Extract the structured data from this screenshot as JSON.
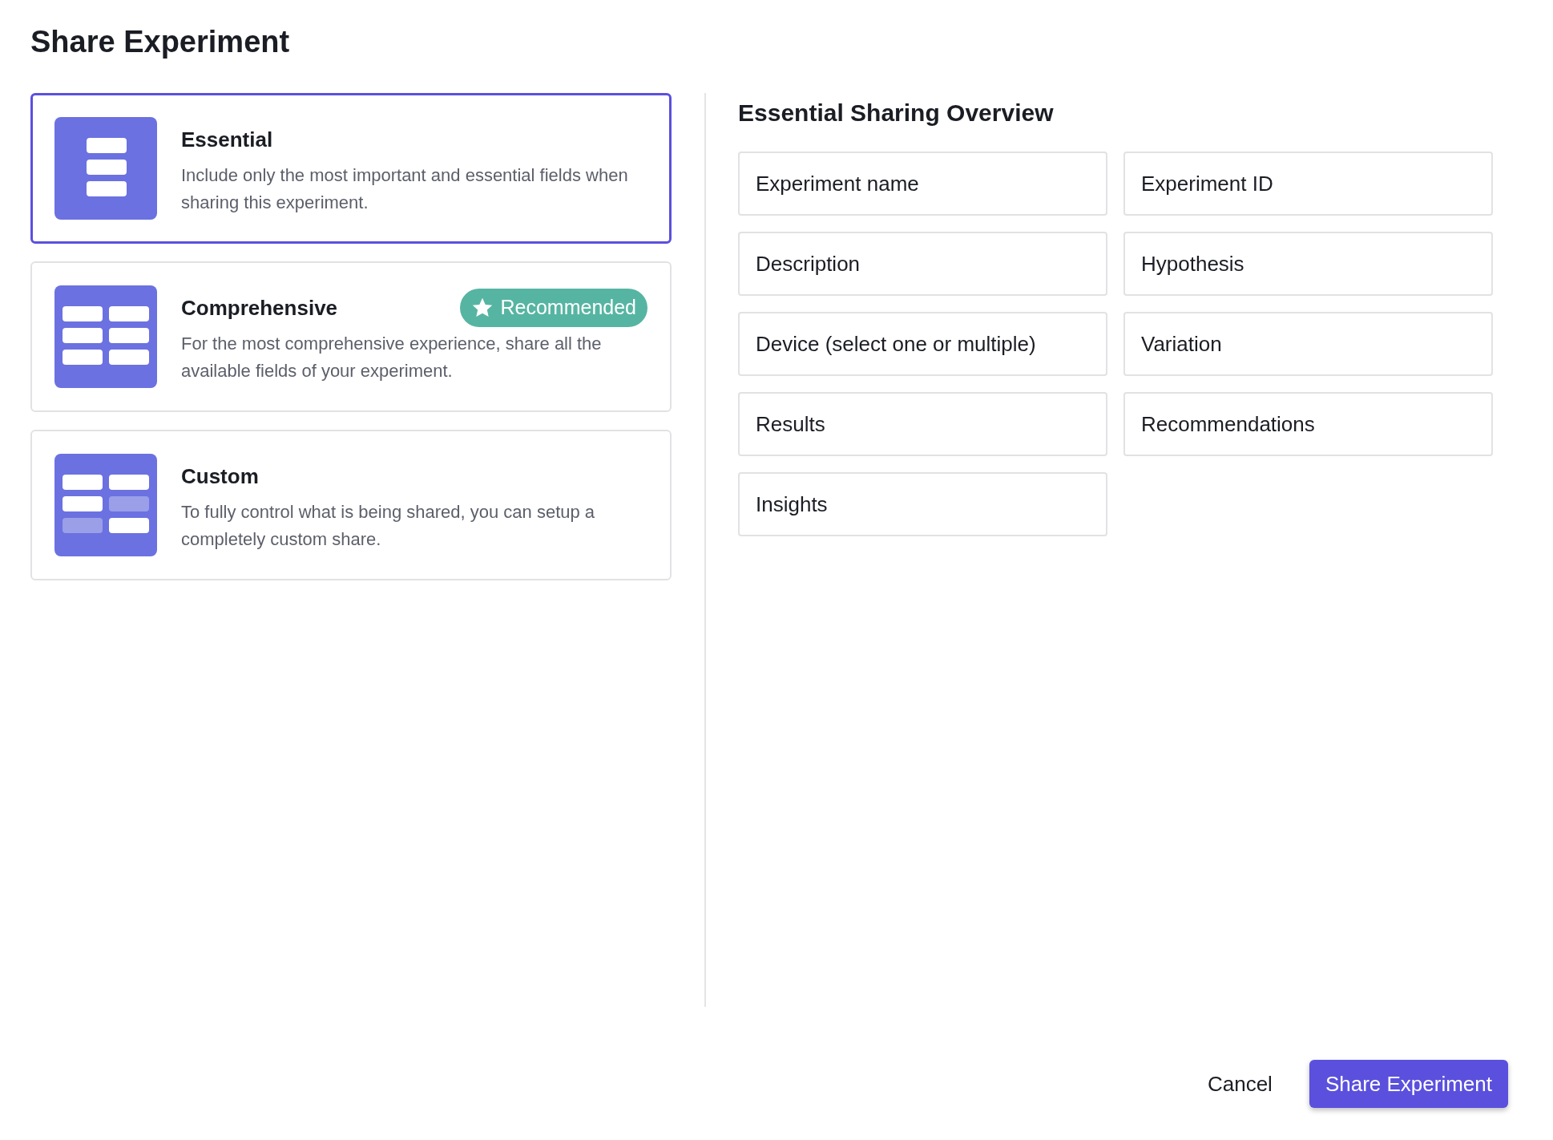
{
  "title": "Share Experiment",
  "options": [
    {
      "kind": "single",
      "title": "Essential",
      "description": "Include only the most important and essential fields when sharing this experiment.",
      "selected": true
    },
    {
      "kind": "double",
      "title": "Comprehensive",
      "description": "For the most comprehensive experience, share all the available fields of your experiment.",
      "selected": false,
      "badge": "Recommended"
    },
    {
      "kind": "mixed",
      "title": "Custom",
      "description": "To fully control what is being shared, you can setup a completely custom share.",
      "selected": false
    }
  ],
  "overview": {
    "title": "Essential Sharing Overview",
    "fields": [
      "Experiment name",
      "Experiment ID",
      "Description",
      "Hypothesis",
      "Device (select one or multiple)",
      "Variation",
      "Results",
      "Recommendations",
      "Insights"
    ]
  },
  "buttons": {
    "cancel": "Cancel",
    "submit": "Share Experiment"
  }
}
